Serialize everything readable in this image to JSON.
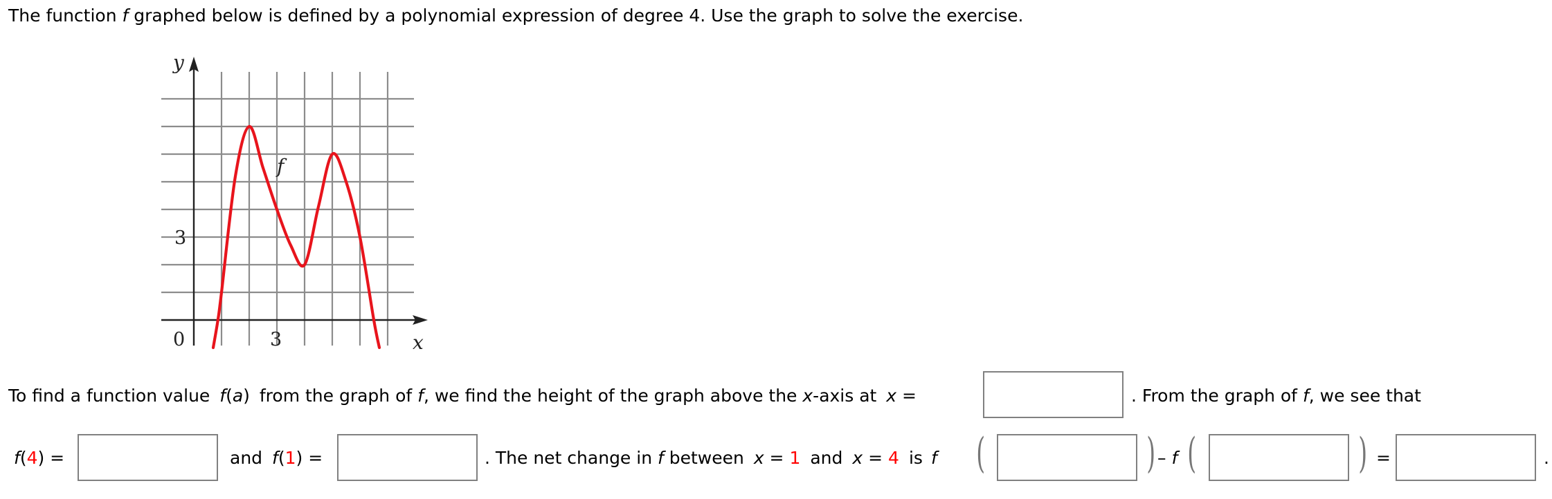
{
  "prompt": {
    "part1": "The function ",
    "f": "f",
    "part2": " graphed below is defined by a polynomial expression of degree 4. Use the graph to solve the exercise."
  },
  "chart_data": {
    "type": "line",
    "title": "",
    "xlabel": "x",
    "ylabel": "y",
    "curve_label": "f",
    "x_tick_labels": [
      {
        "value": 0,
        "label": "0"
      },
      {
        "value": 3,
        "label": "3"
      }
    ],
    "y_tick_labels": [
      {
        "value": 3,
        "label": "3"
      }
    ],
    "xlim": [
      -1,
      8
    ],
    "ylim": [
      -1,
      9
    ],
    "grid": true,
    "grid_step": 1,
    "series": [
      {
        "name": "f",
        "color": "#e8141c",
        "x": [
          0.7,
          0.87,
          1,
          1.5,
          2,
          2.5,
          3,
          3.5,
          4,
          4.5,
          5,
          5.5,
          6,
          6.5,
          6.7
        ],
        "y": [
          -1,
          0,
          1.0,
          5.2,
          7,
          5.5,
          4,
          2.7,
          2,
          4.1,
          6,
          5.0,
          3,
          0,
          -1
        ]
      }
    ],
    "key_points": [
      {
        "x": 2,
        "y": 7,
        "note": "local max"
      },
      {
        "x": 4,
        "y": 2,
        "note": "local min"
      },
      {
        "x": 5,
        "y": 6,
        "note": "local max"
      }
    ]
  },
  "row1": {
    "text1": "To find a function value ",
    "fa_f": "f",
    "fa_open": "(",
    "fa_a": "a",
    "fa_close": ")",
    "text2": " from the graph of ",
    "f": "f",
    "text3": ", we find the height of the graph above the ",
    "x": "x",
    "text4": "-axis at ",
    "x_eq_x": "x",
    "x_eq": " =",
    "after_box": ".  From the graph of ",
    "f2": "f",
    "text5": ", we see that",
    "box_value": ""
  },
  "row2": {
    "f4_f": "f",
    "f4_open": "(",
    "f4_arg": "4",
    "f4_close": ") =",
    "f4_value": "",
    "and": "and",
    "f1_f": "f",
    "f1_open": "(",
    "f1_arg": "1",
    "f1_close": ") =",
    "f1_value": "",
    "net1": ".  The net change in ",
    "net_f": "f",
    "net2": " between ",
    "x1_x": "x",
    "x1_eq": " = ",
    "x1_val": "1",
    "and2": "and",
    "x2_x": "x",
    "x2_eq": " = ",
    "x2_val": "4",
    "is": "is",
    "ff1": "f",
    "minus": "–",
    "ff2": "f",
    "equals": "=",
    "ff1_value": "",
    "ff2_value": "",
    "result_value": "",
    "period": "."
  },
  "paren_open": "(",
  "paren_close": ")"
}
